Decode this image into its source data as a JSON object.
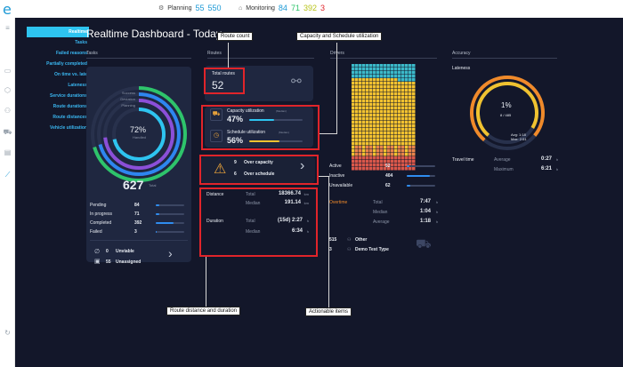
{
  "topbar": {
    "planning_label": "Planning",
    "planning_a": "55",
    "planning_b": "550",
    "monitoring_label": "Monitoring",
    "monitoring_a": "84",
    "monitoring_b": "71",
    "monitoring_c": "392",
    "monitoring_d": "3"
  },
  "menu": [
    "Realtime",
    "Tasks",
    "Failed reasons",
    "Partially completed",
    "On time vs. late",
    "Lateness",
    "Service durations",
    "Route durations",
    "Route distances",
    "Vehicle utilization"
  ],
  "title": "Realtime Dashboard - Today",
  "sections": {
    "tasks": "Tasks",
    "routes": "Routes",
    "drivers": "Drivers",
    "accuracy": "Accuracy"
  },
  "tasks": {
    "legend": [
      "Success",
      "Deviation",
      "Planning"
    ],
    "pct": "72%",
    "pct_label": "Handled",
    "total": "627",
    "total_label": "Total",
    "rows": [
      {
        "label": "Pending",
        "value": "84",
        "fill": 0.13
      },
      {
        "label": "In progress",
        "value": "71",
        "fill": 0.11
      },
      {
        "label": "Completed",
        "value": "392",
        "fill": 0.63
      },
      {
        "label": "Failed",
        "value": "3",
        "fill": 0.01
      }
    ],
    "unviable_count": "0",
    "unviable_label": "Unviable",
    "unassigned_count": "55",
    "unassigned_label": "Unassigned"
  },
  "routes": {
    "total_label": "Total routes",
    "total": "52",
    "capacity_label": "Capacity utilization",
    "capacity_tag": "(Median)",
    "capacity_value": "47%",
    "capacity_fill": 0.47,
    "schedule_label": "Schedule utilization",
    "schedule_tag": "(Median)",
    "schedule_value": "56%",
    "schedule_fill": 0.56,
    "over_capacity_count": "9",
    "over_capacity_label": "Over capacity",
    "over_schedule_count": "6",
    "over_schedule_label": "Over schedule",
    "distance_label": "Distance",
    "distance_total_label": "Total",
    "distance_total": "18366.74",
    "distance_total_unit": "km",
    "distance_median_label": "Median",
    "distance_median": "191.14",
    "distance_median_unit": "km",
    "duration_label": "Duration",
    "duration_total_label": "Total",
    "duration_total": "(15d) 2:27",
    "duration_total_unit": "h",
    "duration_median_label": "Median",
    "duration_median": "6:34",
    "duration_median_unit": "h"
  },
  "drivers": {
    "rows": [
      {
        "label": "Active",
        "value": "52",
        "fill": 0.1
      },
      {
        "label": "Inactive",
        "value": "404",
        "fill": 0.8
      },
      {
        "label": "Unavailable",
        "value": "62",
        "fill": 0.12
      }
    ],
    "overtime_label": "Overtime",
    "overtime_rows": [
      {
        "label": "Total",
        "value": "7:47",
        "unit": "h"
      },
      {
        "label": "Median",
        "value": "1:04",
        "unit": "h"
      },
      {
        "label": "Average",
        "value": "1:18",
        "unit": "h"
      }
    ],
    "types": [
      {
        "count": "515",
        "label": "Other"
      },
      {
        "count": "3",
        "label": "Demo Test Type"
      }
    ]
  },
  "accuracy": {
    "lateness_label": "Lateness",
    "pct": "1%",
    "ratio": "8 / 485",
    "avg": "Avg: 1:18",
    "max": "Max: 2:51",
    "travel_label": "Travel time",
    "travel_rows": [
      {
        "label": "Average",
        "value": "0:27",
        "unit": "h"
      },
      {
        "label": "Maximum",
        "value": "6:21",
        "unit": "h"
      }
    ]
  },
  "callouts": {
    "route_count": "Route count",
    "capacity_schedule": "Capacity and Schedule utilization",
    "distance_duration": "Route distance and duration",
    "actionable": "Actionable items"
  },
  "colors": {
    "success": "#2ec46b",
    "deviation": "#2e86f0",
    "planning": "#8b4fd8",
    "accent": "#2ec4f0",
    "annotation": "#e0242a",
    "heat_top": "#3bb9c9",
    "heat_mid": "#f2c230",
    "heat_low": "#e9844a",
    "heat_bottom": "#d9574a",
    "lateness_inner": "#f0c230",
    "lateness_outer": "#f08a2a"
  }
}
